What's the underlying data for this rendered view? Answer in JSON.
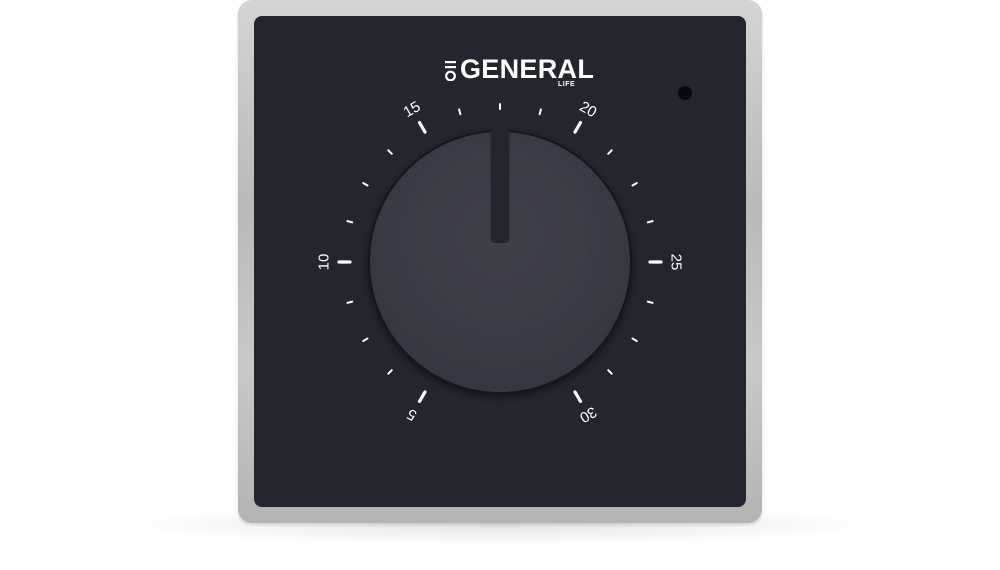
{
  "brand": {
    "name": "GENERAL",
    "sub": "LIFE"
  },
  "dial": {
    "scale_labels": [
      "5",
      "10",
      "15",
      "20",
      "25",
      "30"
    ],
    "scale_min": 5,
    "scale_max": 30,
    "setting": 17.5
  },
  "colors": {
    "panel": "#24262f",
    "knob": "#3b3d47",
    "frame": "#c4c4c4",
    "markings": "#ffffff"
  }
}
